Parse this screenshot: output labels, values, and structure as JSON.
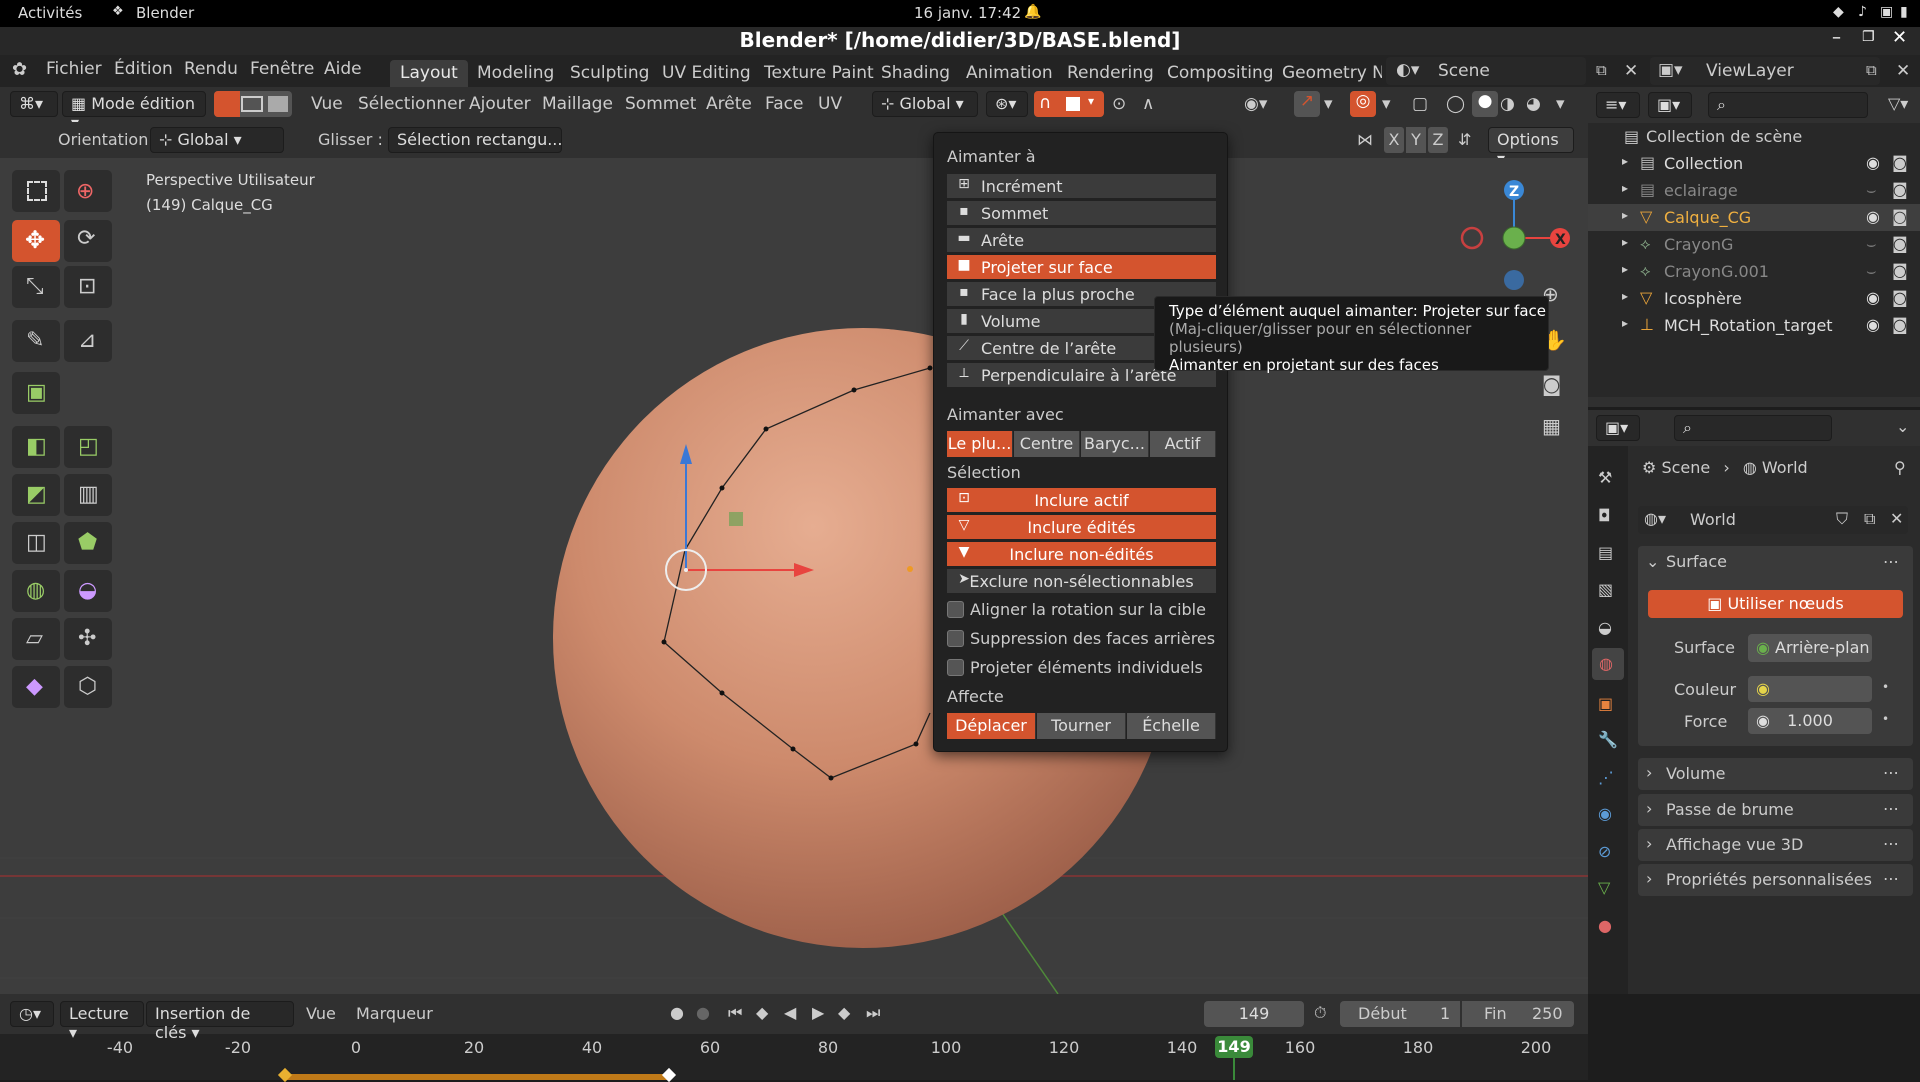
{
  "gnome": {
    "activities": "Activités",
    "app": "Blender",
    "clock": "16 janv.  17:42"
  },
  "window": {
    "title": "Blender* [/home/didier/3D/BASE.blend]"
  },
  "menu": [
    "Fichier",
    "Édition",
    "Rendu",
    "Fenêtre",
    "Aide"
  ],
  "workspaces": [
    "Layout",
    "Modeling",
    "Sculpting",
    "UV Editing",
    "Texture Paint",
    "Shading",
    "Animation",
    "Rendering",
    "Compositing",
    "Geometry Nc"
  ],
  "active_workspace": "Layout",
  "scene": "Scene",
  "viewlayer": "ViewLayer",
  "header": {
    "mode": "Mode édition",
    "items": [
      "Vue",
      "Sélectionner",
      "Ajouter",
      "Maillage",
      "Sommet",
      "Arête",
      "Face",
      "UV"
    ],
    "transform": "Global"
  },
  "tool_settings": {
    "orientation_label": "Orientation:",
    "orientation_value": "Global",
    "drag_label": "Glisser :",
    "drag_value": "Sélection rectangu...",
    "axes": [
      "X",
      "Y",
      "Z"
    ],
    "options": "Options"
  },
  "viewport": {
    "line1": "Perspective Utilisateur",
    "line2": "(149) Calque_CG"
  },
  "snap_menu": {
    "title": "Aimanter à",
    "targets": [
      {
        "label": "Incrément",
        "on": false
      },
      {
        "label": "Sommet",
        "on": false
      },
      {
        "label": "Arête",
        "on": false
      },
      {
        "label": "Projeter sur face",
        "on": true
      },
      {
        "label": "Face la plus proche",
        "on": false
      },
      {
        "label": "Volume",
        "on": false
      },
      {
        "label": "Centre de l’arête",
        "on": false
      },
      {
        "label": "Perpendiculaire à l’arête",
        "on": false
      }
    ],
    "with_title": "Aimanter avec",
    "with": [
      {
        "label": "Le plu...",
        "on": true
      },
      {
        "label": "Centre",
        "on": false
      },
      {
        "label": "Baryc...",
        "on": false
      },
      {
        "label": "Actif",
        "on": false
      }
    ],
    "selection_title": "Sélection",
    "selection": [
      {
        "label": "Inclure actif",
        "on": true
      },
      {
        "label": "Inclure édités",
        "on": true
      },
      {
        "label": "Inclure non-édités",
        "on": true
      },
      {
        "label": "Exclure non-sélectionnables",
        "on": false
      }
    ],
    "checks": [
      "Aligner la rotation sur la cible",
      "Suppression des faces arrières",
      "Projeter éléments individuels"
    ],
    "affect_title": "Affecte",
    "affect": [
      {
        "label": "Déplacer",
        "on": true
      },
      {
        "label": "Tourner",
        "on": false
      },
      {
        "label": "Échelle",
        "on": false
      }
    ]
  },
  "tooltip": {
    "l1a": "Type d’élément auquel aimanter:",
    "l1b": "Projeter sur face",
    "l2": "(Maj-cliquer/glisser pour en sélectionner plusieurs)",
    "l3": "Aimanter en projetant sur des faces"
  },
  "outliner": {
    "root": "Collection de scène",
    "rows": [
      {
        "name": "Collection",
        "sel": false,
        "dim": false
      },
      {
        "name": "eclairage",
        "sel": false,
        "dim": true
      },
      {
        "name": "Calque_CG",
        "sel": true,
        "dim": false
      },
      {
        "name": "CrayonG",
        "sel": false,
        "dim": true
      },
      {
        "name": "CrayonG.001",
        "sel": false,
        "dim": true
      },
      {
        "name": "Icosphère",
        "sel": false,
        "dim": false
      },
      {
        "name": "MCH_Rotation_target",
        "sel": false,
        "dim": false
      }
    ]
  },
  "properties": {
    "crumb1": "Scene",
    "crumb2": "World",
    "world": "World",
    "surface_panel": "Surface",
    "use_nodes": "Utiliser nœuds",
    "surface_label": "Surface",
    "surface_value": "Arrière-plan",
    "color_label": "Couleur",
    "force_label": "Force",
    "force_value": "1.000",
    "panels": [
      "Volume",
      "Passe de brume",
      "Affichage vue 3D",
      "Propriétés personnalisées"
    ]
  },
  "timeline": {
    "playback": "Lecture",
    "keying": "Insertion de clés",
    "view": "Vue",
    "marker": "Marqueur",
    "current": "149",
    "start_label": "Début",
    "start": "1",
    "end_label": "Fin",
    "end": "250",
    "ticks": [
      "-40",
      "-20",
      "0",
      "20",
      "40",
      "60",
      "80",
      "100",
      "120",
      "140",
      "160",
      "180",
      "200"
    ]
  },
  "colors": {
    "accent": "#d4542e",
    "x": "#e8443f",
    "y": "#6ab04c",
    "z": "#3a88d6"
  }
}
